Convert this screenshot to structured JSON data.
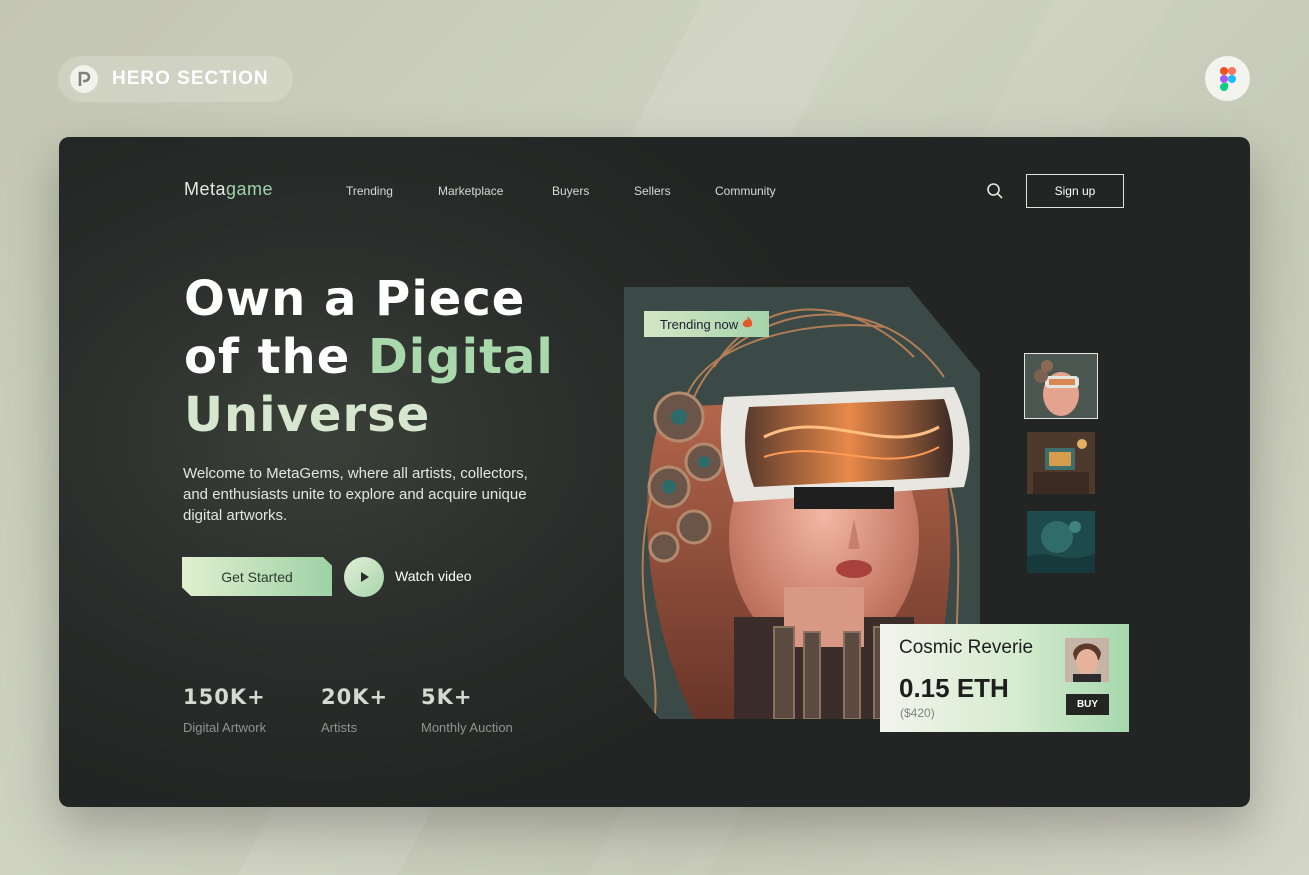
{
  "badge": {
    "label": "HERO SECTION",
    "logo_icon": "p-logo-icon"
  },
  "figma_icon": "figma-icon",
  "nav": {
    "logo_prefix": "Meta",
    "logo_accent": "game",
    "items": [
      "Trending",
      "Marketplace",
      "Buyers",
      "Sellers",
      "Community"
    ],
    "search_icon": "search-icon",
    "signup_label": "Sign up"
  },
  "hero": {
    "line1": "Own a Piece",
    "line2_white": "of the ",
    "line2_green": "Digital",
    "line3": "Universe",
    "description": "Welcome to MetaGems, where all artists, collectors, and enthusiasts unite to explore and acquire unique digital artworks.",
    "cta_label": "Get Started",
    "watch_label": "Watch video"
  },
  "stats": [
    {
      "value": "150K+",
      "label": "Digital Artwork"
    },
    {
      "value": "20K+",
      "label": "Artists"
    },
    {
      "value": "5K+",
      "label": "Monthly Auction"
    }
  ],
  "artwork": {
    "trending_label": "Trending now",
    "trending_icon": "fire-icon",
    "card": {
      "title": "Cosmic Reverie",
      "price": "0.15 ETH",
      "usd": "($420)",
      "buy_label": "BUY"
    }
  },
  "colors": {
    "accent_green": "#a8d8ab",
    "dark_bg": "#2a2d2b"
  }
}
